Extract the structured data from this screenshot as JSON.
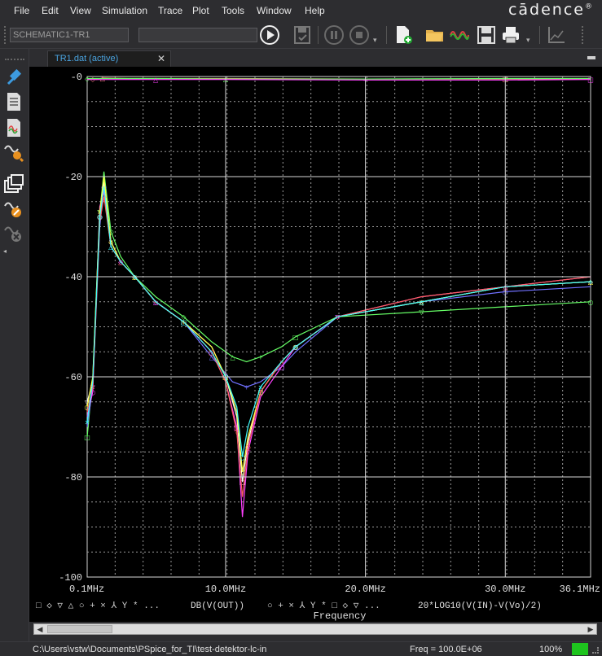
{
  "menu": {
    "items": [
      "File",
      "Edit",
      "View",
      "Simulation",
      "Trace",
      "Plot",
      "Tools",
      "Window",
      "Help"
    ],
    "brand": "cādence",
    "brand_mark": "®"
  },
  "toolbar": {
    "profile_value": "SCHEMATIC1-TR1",
    "second_value": ""
  },
  "tab": {
    "label": "TR1.dat (active)",
    "close": "✕"
  },
  "plot": {
    "x_ticks": [
      {
        "v": 0.1,
        "label": "0.1MHz"
      },
      {
        "v": 10.0,
        "label": "10.0MHz"
      },
      {
        "v": 20.0,
        "label": "20.0MHz"
      },
      {
        "v": 30.0,
        "label": "30.0MHz"
      },
      {
        "v": 36.1,
        "label": "36.1MHz"
      }
    ],
    "y_ticks": [
      {
        "v": 0,
        "label": "-0"
      },
      {
        "v": -20,
        "label": "-20"
      },
      {
        "v": -40,
        "label": "-40"
      },
      {
        "v": -60,
        "label": "-60"
      },
      {
        "v": -80,
        "label": "-80"
      },
      {
        "v": -100,
        "label": "-100"
      }
    ],
    "x_axis_title": "Frequency",
    "legend_markers_1": "□ ◇ ▽ △ ○ + × ⅄ Y * ...",
    "legend_trace_1": "DB(V(OUT))",
    "legend_markers_2": "○ + × ⅄ Y * □ ◇ ▽ ...",
    "legend_trace_2": "20*LOG10(V(IN)-V(Vo)/2)"
  },
  "chart_data": {
    "type": "line",
    "xlabel": "Frequency",
    "ylabel": "",
    "xlim": [
      0.1,
      36.1
    ],
    "ylim": [
      -100,
      0
    ],
    "grid": true,
    "series": [
      {
        "color": "#66ff66",
        "x": [
          0.1,
          0.5,
          1.0,
          1.3,
          1.8,
          2.5,
          3.5,
          5,
          7,
          9,
          10.5,
          11.5,
          12.5,
          14,
          15,
          18,
          24,
          30,
          36.1
        ],
        "values": [
          -72,
          -60,
          -27,
          -19,
          -31,
          -36,
          -40,
          -44,
          -48,
          -53,
          -56,
          -57,
          -56,
          -54,
          -52,
          -48,
          -47,
          -46,
          -45
        ]
      },
      {
        "color": "#7070ff",
        "x": [
          0.1,
          0.5,
          1.0,
          1.3,
          1.8,
          2.5,
          3.5,
          5,
          7,
          9,
          10.5,
          11.5,
          12.5,
          14,
          15,
          18,
          24,
          30,
          36.1
        ],
        "values": [
          -70,
          -62,
          -30,
          -22,
          -33,
          -37,
          -40,
          -45,
          -49,
          -56,
          -61,
          -62,
          -61,
          -58,
          -55,
          -48,
          -45,
          -43,
          -42
        ]
      },
      {
        "color": "#ffffff",
        "x": [
          0.1,
          0.5,
          1.0,
          1.3,
          1.8,
          2.5,
          3.5,
          5,
          7,
          9,
          10,
          10.8,
          11.2,
          11.6,
          12.5,
          14,
          15,
          18,
          24,
          30,
          36.1
        ],
        "values": [
          -65,
          -61,
          -28,
          -21,
          -33,
          -37,
          -40,
          -45,
          -49,
          -54,
          -60,
          -68,
          -81,
          -73,
          -63,
          -57,
          -54,
          -48,
          -45,
          -42,
          -41
        ]
      },
      {
        "color": "#ff40ff",
        "x": [
          0.1,
          0.5,
          1.0,
          1.3,
          1.8,
          2.5,
          3.5,
          5,
          7,
          9,
          10,
          10.8,
          11.2,
          11.6,
          12.5,
          14,
          15,
          18,
          24,
          30,
          36.1
        ],
        "values": [
          -68,
          -63,
          -26,
          -23,
          -34,
          -37,
          -40,
          -45,
          -49,
          -55,
          -61,
          -70,
          -88,
          -75,
          -64,
          -58,
          -54,
          -48,
          -44,
          -42,
          -40
        ]
      },
      {
        "color": "#ffff40",
        "x": [
          0.1,
          0.5,
          1.0,
          1.3,
          1.8,
          2.5,
          3.5,
          5,
          7,
          9,
          10,
          10.8,
          11.2,
          11.6,
          12.5,
          14,
          15,
          18,
          24,
          30,
          36.1
        ],
        "values": [
          -66,
          -60,
          -27,
          -20,
          -33,
          -37,
          -40,
          -45,
          -49,
          -54,
          -60,
          -67,
          -79,
          -72,
          -63,
          -57,
          -54,
          -48,
          -45,
          -42,
          -41
        ]
      },
      {
        "color": "#ff6060",
        "x": [
          0.1,
          0.5,
          1.0,
          1.3,
          1.8,
          2.5,
          3.5,
          5,
          7,
          9,
          10,
          10.8,
          11.2,
          11.6,
          12.5,
          14,
          15,
          18,
          24,
          30,
          36.1
        ],
        "values": [
          -67,
          -62,
          -29,
          -24,
          -34,
          -37,
          -40,
          -45,
          -49,
          -55,
          -61,
          -71,
          -84,
          -74,
          -63,
          -57,
          -54,
          -48,
          -44,
          -42,
          -40
        ]
      },
      {
        "color": "#40ffff",
        "x": [
          0.1,
          0.5,
          1.0,
          1.3,
          1.8,
          2.5,
          3.5,
          5,
          7,
          9,
          10,
          10.8,
          11.2,
          11.6,
          12.5,
          14,
          15,
          18,
          24,
          30,
          36.1
        ],
        "values": [
          -69,
          -61,
          -28,
          -22,
          -34,
          -37,
          -40,
          -45,
          -49,
          -55,
          -60,
          -66,
          -76,
          -70,
          -62,
          -57,
          -54,
          -48,
          -45,
          -42,
          -41
        ]
      },
      {
        "color": "#ff8080",
        "x": [
          0.1,
          0.5,
          0.8,
          1.2,
          3,
          10,
          20,
          30,
          36.1
        ],
        "values": [
          -0.5,
          -0.5,
          -0.6,
          -0.3,
          -0.4,
          -0.4,
          -0.5,
          -0.5,
          -0.5
        ]
      },
      {
        "color": "#66ff66",
        "x": [
          0.1,
          5,
          10,
          20,
          30,
          36.1
        ],
        "values": [
          -0.4,
          -0.4,
          -0.5,
          -0.5,
          -0.4,
          -0.4
        ]
      },
      {
        "color": "#ff40ff",
        "x": [
          0.1,
          5,
          10,
          20,
          30,
          36.1
        ],
        "values": [
          -0.6,
          -0.6,
          -0.6,
          -0.7,
          -0.7,
          -0.6
        ]
      }
    ]
  },
  "status": {
    "path": "C:\\Users\\vstw\\Documents\\PSpice_for_TI\\test-detektor-lc-in",
    "freq": "Freq = 100.0E+06",
    "zoom": "100%"
  }
}
